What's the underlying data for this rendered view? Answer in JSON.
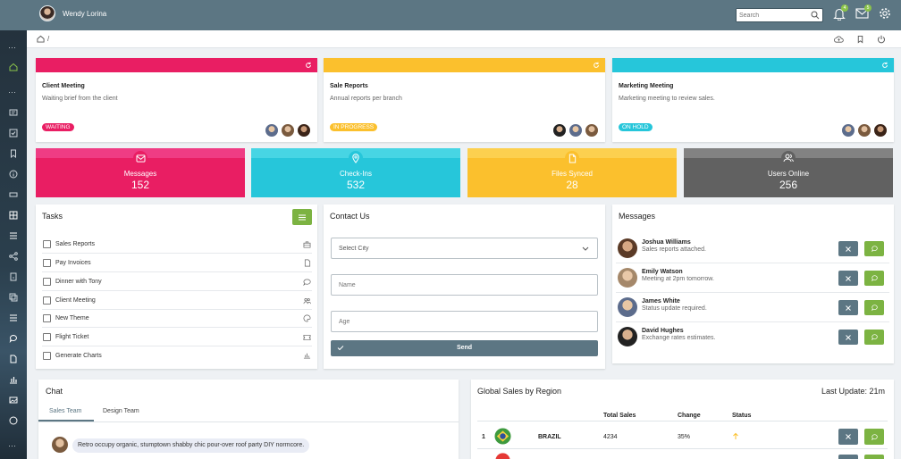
{
  "header": {
    "user_name": "Wendy Lorina",
    "search_placeholder": "Search",
    "notifications_count": "4",
    "mail_count": "5"
  },
  "breadcrumb": {
    "separator": "/"
  },
  "info_cards": [
    {
      "title": "Client Meeting",
      "description": "Waiting brief from the client",
      "status": "WAITING",
      "color": "#e91e63"
    },
    {
      "title": "Sale Reports",
      "description": "Annual reports per branch",
      "status": "IN PROGRESS",
      "color": "#fbc02d"
    },
    {
      "title": "Marketing Meeting",
      "description": "Marketing meeting to review sales.",
      "status": "ON HOLD",
      "color": "#26c6da"
    }
  ],
  "stats": [
    {
      "label": "Messages",
      "value": "152",
      "color": "#e91e63"
    },
    {
      "label": "Check-Ins",
      "value": "532",
      "color": "#26c6da"
    },
    {
      "label": "Files Synced",
      "value": "28",
      "color": "#fbc02d"
    },
    {
      "label": "Users Online",
      "value": "256",
      "color": "#616161"
    }
  ],
  "tasks": {
    "title": "Tasks",
    "items": [
      {
        "label": "Sales Reports",
        "icon": "briefcase-icon"
      },
      {
        "label": "Pay Invoices",
        "icon": "document-icon"
      },
      {
        "label": "Dinner with Tony",
        "icon": "chat-icon"
      },
      {
        "label": "Client Meeting",
        "icon": "users-icon"
      },
      {
        "label": "New Theme",
        "icon": "palette-icon"
      },
      {
        "label": "Flight Ticket",
        "icon": "ticket-icon"
      },
      {
        "label": "Generate Charts",
        "icon": "bar-chart-icon"
      }
    ]
  },
  "contact": {
    "title": "Contact Us",
    "city_placeholder": "Select City",
    "name_placeholder": "Name",
    "age_placeholder": "Age",
    "send_label": "Send"
  },
  "messages": {
    "title": "Messages",
    "items": [
      {
        "name": "Joshua Williams",
        "text": "Sales reports attached."
      },
      {
        "name": "Emily Watson",
        "text": "Meeting at 2pm tomorrow."
      },
      {
        "name": "James White",
        "text": "Status update required."
      },
      {
        "name": "David Hughes",
        "text": "Exchange rates estimates."
      }
    ]
  },
  "chat": {
    "title": "Chat",
    "tabs": [
      "Sales Team",
      "Design Team"
    ],
    "active_tab": "Sales Team",
    "messages": [
      {
        "text": "Retro occupy organic, stumptown shabby chic pour-over roof party DIY normcore."
      }
    ]
  },
  "sales": {
    "title": "Global Sales by Region",
    "last_update": "Last Update: 21m",
    "columns": [
      "Total Sales",
      "Change",
      "Status"
    ],
    "rows": [
      {
        "rank": "1",
        "country": "BRAZIL",
        "total": "4234",
        "change": "35%",
        "status": "up"
      }
    ]
  },
  "colors": {
    "accent": "#5c7683",
    "green": "#7cb342"
  }
}
